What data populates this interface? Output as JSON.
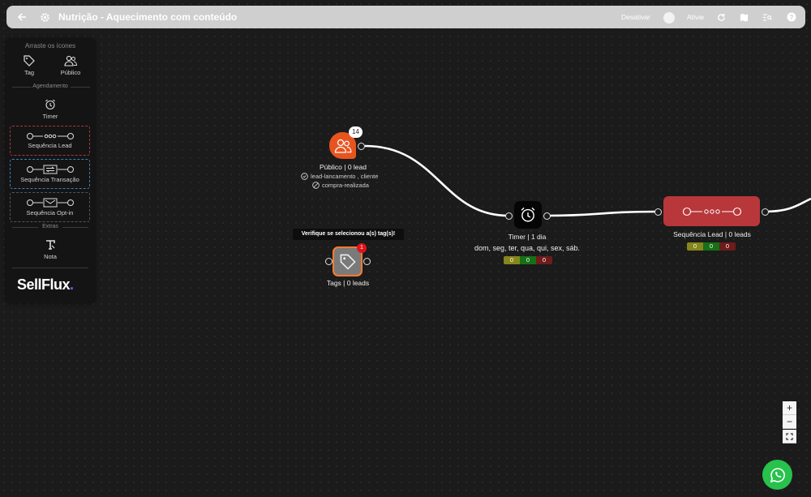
{
  "header": {
    "title": "Nutrição - Aquecimento com conteúdo",
    "deactivate_label": "Desativar",
    "activate_label": "Ativar"
  },
  "sidebar": {
    "heading": "Arraste os ícones",
    "tag_label": "Tag",
    "audience_label": "Público",
    "scheduling_label": "Agendamento",
    "timer_label": "Timer",
    "seq_lead_label": "Sequência Lead",
    "seq_transaction_label": "Sequência Transação",
    "seq_optin_label": "Sequência Opt-in",
    "extras_label": "Extras",
    "note_label": "Nota",
    "logo_text": "SellFlux",
    "logo_dot": "."
  },
  "canvas": {
    "publico": {
      "badge": "14",
      "label": "Público | 0 lead",
      "condition_1": "lead-lancamento , cliente",
      "condition_2": "compra-realizada"
    },
    "tags": {
      "tooltip": "Verifique se selecionou a(s) tag(s)!",
      "badge": "1",
      "label": "Tags | 0 leads"
    },
    "timer": {
      "label": "Timer | 1 dia",
      "days": "dom, seg, ter, qua, qui, sex, sáb.",
      "counts": [
        "0",
        "0",
        "0"
      ]
    },
    "seq_lead": {
      "label": "Sequência Lead | 0 leads",
      "counts": [
        "0",
        "0",
        "0"
      ]
    }
  },
  "zoom": {
    "in": "+",
    "out": "−"
  },
  "colors": {
    "publico_node": "#e8541f",
    "seq_lead_node": "#b7373a",
    "tags_border": "#ff7a33",
    "whatsapp": "#27c24c"
  }
}
